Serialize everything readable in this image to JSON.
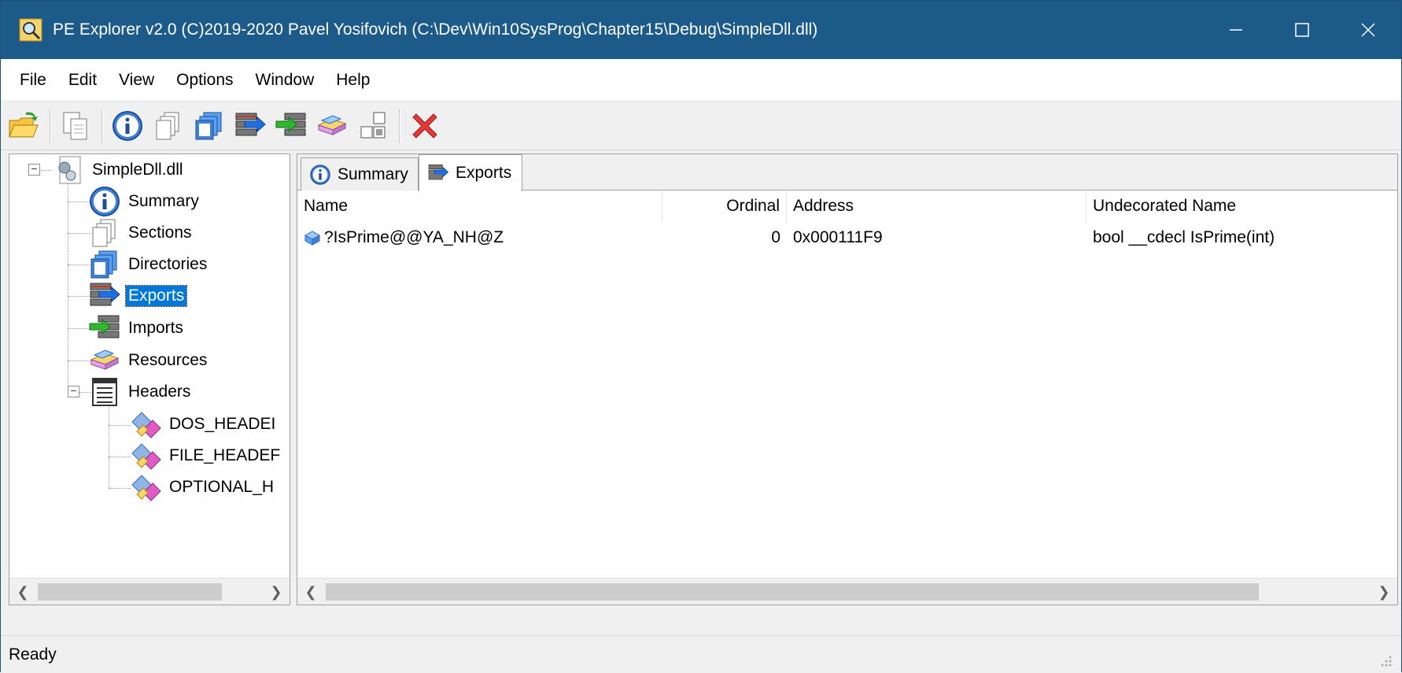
{
  "window": {
    "title": "PE Explorer v2.0 (C)2019-2020 Pavel Yosifovich (C:\\Dev\\Win10SysProg\\Chapter15\\Debug\\SimpleDll.dll)",
    "accent_color": "#1c5a8a"
  },
  "menu": {
    "items": [
      "File",
      "Edit",
      "View",
      "Options",
      "Window",
      "Help"
    ]
  },
  "toolbar": {
    "icons": [
      "open-folder-icon",
      "copy-icon",
      "info-icon",
      "sections-icon",
      "directories-icon",
      "exports-icon",
      "imports-icon",
      "resources-icon",
      "headers-icon",
      "close-red-x-icon"
    ]
  },
  "tree": {
    "root": "SimpleDll.dll",
    "items": [
      "Summary",
      "Sections",
      "Directories",
      "Exports",
      "Imports",
      "Resources",
      "Headers"
    ],
    "selected": "Exports",
    "header_children": [
      "DOS_HEADEI",
      "FILE_HEADEF",
      "OPTIONAL_H"
    ]
  },
  "tabs": [
    {
      "label": "Summary",
      "icon": "info-icon"
    },
    {
      "label": "Exports",
      "icon": "exports-icon"
    }
  ],
  "exports": {
    "columns": [
      "Name",
      "Ordinal",
      "Address",
      "Undecorated Name"
    ],
    "rows": [
      {
        "name": "?IsPrime@@YA_NH@Z",
        "ordinal": "0",
        "address": "0x000111F9",
        "undecorated": "bool __cdecl IsPrime(int)"
      }
    ]
  },
  "status": {
    "text": "Ready"
  }
}
